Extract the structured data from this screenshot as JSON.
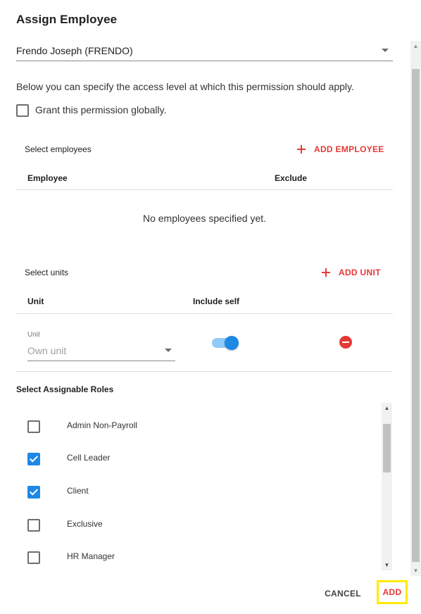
{
  "dialog": {
    "title": "Assign Employee",
    "employee_value": "Frendo Joseph (FRENDO)",
    "description": "Below you can specify the access level at which this permission should apply.",
    "grant_global_label": "Grant this permission globally.",
    "grant_global_checked": false
  },
  "employees_section": {
    "label": "Select employees",
    "add_label": "ADD EMPLOYEE",
    "columns": [
      "Employee",
      "Exclude"
    ],
    "empty_message": "No employees specified yet."
  },
  "units_section": {
    "label": "Select units",
    "add_label": "ADD UNIT",
    "columns": [
      "Unit",
      "Include self"
    ],
    "row": {
      "field_label": "Unit",
      "field_value": "Own unit",
      "include_self": true
    }
  },
  "roles_section": {
    "label": "Select Assignable Roles",
    "roles": [
      {
        "name": "Admin Non-Payroll",
        "checked": false
      },
      {
        "name": "Cell Leader",
        "checked": true
      },
      {
        "name": "Client",
        "checked": true
      },
      {
        "name": "Exclusive",
        "checked": false
      },
      {
        "name": "HR Manager",
        "checked": false
      }
    ]
  },
  "actions": {
    "cancel_label": "CANCEL",
    "add_label": "ADD"
  },
  "colors": {
    "accent": "#e53935",
    "primary": "#1e88e5",
    "highlight": "#ffeb00"
  }
}
